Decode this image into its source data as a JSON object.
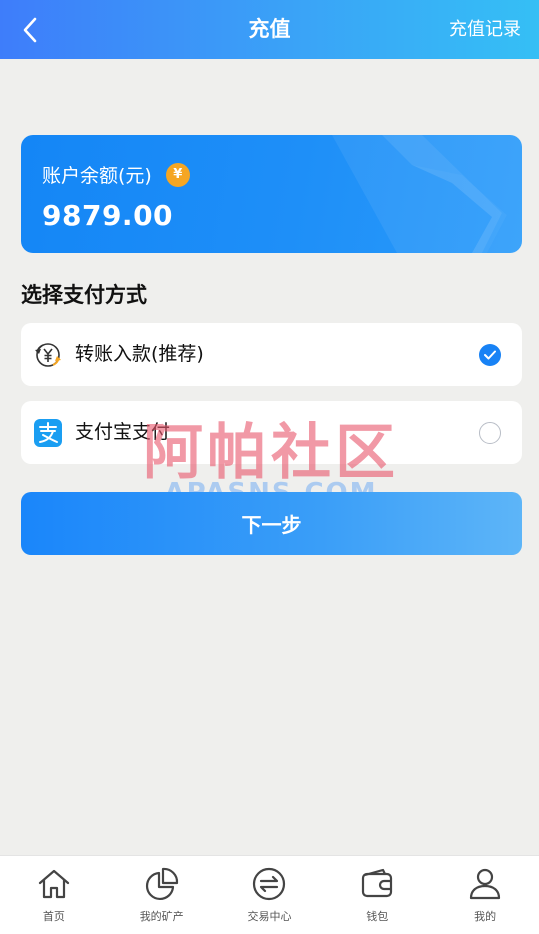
{
  "header": {
    "title": "充值",
    "record_label": "充值记录",
    "back_icon": "chevron-left-icon"
  },
  "balance": {
    "label": "账户余额(元)",
    "currency_symbol": "¥",
    "amount": "9879.00"
  },
  "payment": {
    "section_title": "选择支付方式",
    "options": [
      {
        "name": "转账入款(推荐)",
        "icon": "bank-transfer-icon",
        "selected": true
      },
      {
        "name": "支付宝支付",
        "icon": "alipay-icon",
        "selected": false
      }
    ]
  },
  "watermark": {
    "text_cn": "阿帕社区",
    "text_en": "APASNS.COM"
  },
  "next_button_label": "下一步",
  "nav": {
    "items": [
      {
        "label": "首页",
        "icon": "home-icon"
      },
      {
        "label": "我的矿产",
        "icon": "pie-chart-icon"
      },
      {
        "label": "交易中心",
        "icon": "exchange-icon"
      },
      {
        "label": "钱包",
        "icon": "wallet-icon"
      },
      {
        "label": "我的",
        "icon": "user-icon"
      }
    ]
  },
  "colors": {
    "accent": "#1882f5",
    "header_start": "#3e7dfa",
    "header_end": "#35bff5",
    "coin": "#f5a623",
    "background": "#efefed"
  }
}
